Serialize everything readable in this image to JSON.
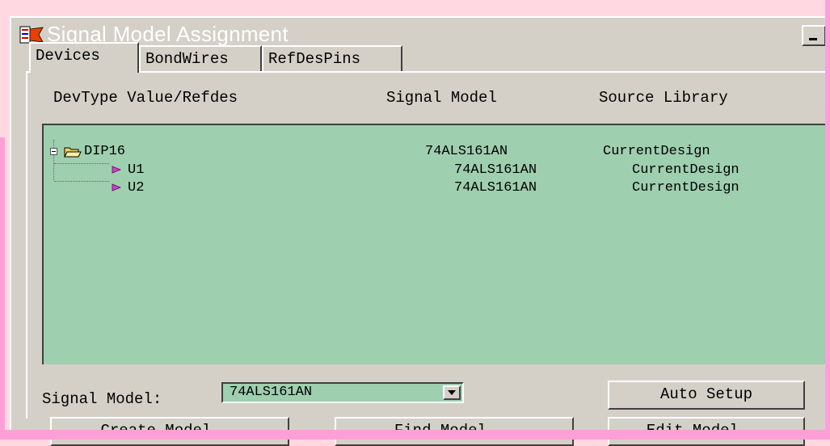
{
  "window": {
    "title": "Signal Model Assignment"
  },
  "tabs": [
    {
      "label": "Devices"
    },
    {
      "label": "BondWires"
    },
    {
      "label": "RefDesPins"
    }
  ],
  "columns": {
    "devtype": "DevType Value/Refdes",
    "signal_model": "Signal Model",
    "source_library": "Source Library"
  },
  "tree": {
    "parent": {
      "name": "DIP16",
      "model": "74ALS161AN",
      "library": "CurrentDesign"
    },
    "children": [
      {
        "name": "U1",
        "model": "74ALS161AN",
        "library": "CurrentDesign"
      },
      {
        "name": "U2",
        "model": "74ALS161AN",
        "library": "CurrentDesign"
      }
    ]
  },
  "signal_model": {
    "label": "Signal Model:",
    "value": "74ALS161AN"
  },
  "buttons": {
    "auto_setup": "Auto Setup",
    "create_model": "Create Model...",
    "find_model": "Find Model...",
    "edit_model": "Edit Model..."
  },
  "colors": {
    "tree_background": "#9ecfaf",
    "dialog_face": "#d4d0c8",
    "page_background": "#ffd8e2",
    "accent_border": "#ff9fd8"
  },
  "icons": {
    "title": "signal-model-app-icon",
    "folder": "open-folder-icon",
    "part": "component-icon",
    "expander": "tree-collapse-icon",
    "dropdown": "chevron-down-icon"
  }
}
